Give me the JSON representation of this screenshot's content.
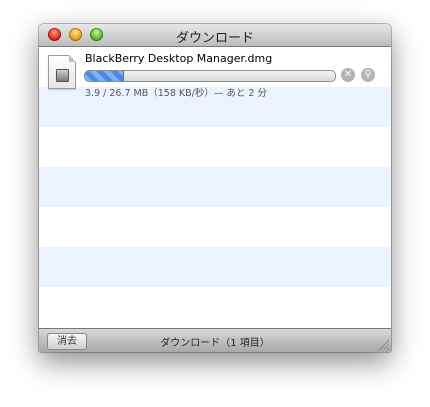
{
  "window": {
    "title": "ダウンロード"
  },
  "download": {
    "filename": "BlackBerry Desktop Manager.dmg",
    "progress_percent": 15,
    "status": "3.9 / 26.7 MB（158 KB/秒）— あと 2 分",
    "file_icon": "dmg-file-icon",
    "cancel_icon": "stop-icon",
    "reveal_icon": "magnifier-icon"
  },
  "footer": {
    "clear_label": "消去",
    "summary": "ダウンロード（1 項目）"
  },
  "colors": {
    "row_alt": "#edf3fe",
    "progress_fill": "#4a8ae6"
  }
}
